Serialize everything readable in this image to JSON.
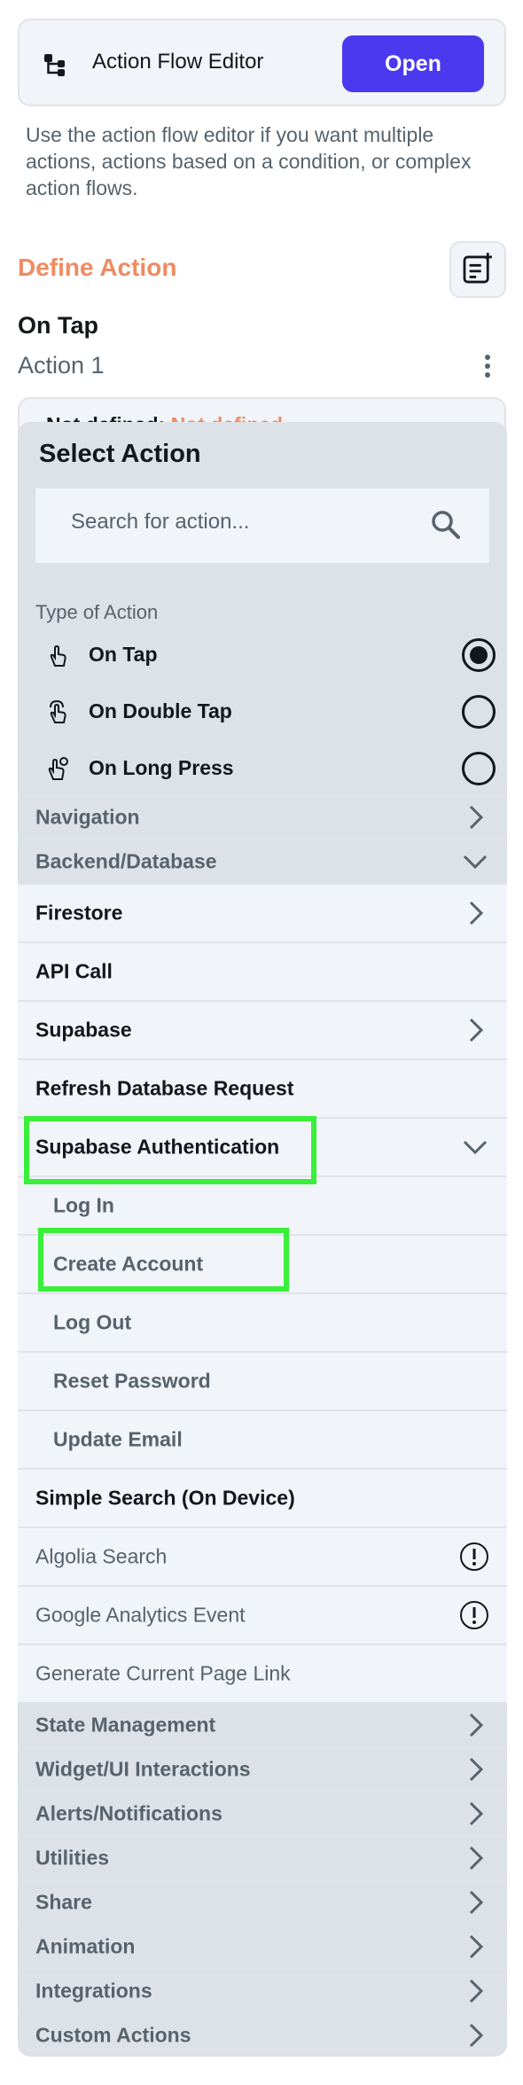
{
  "flow_editor": {
    "title": "Action Flow Editor",
    "open_label": "Open",
    "description": "Use the action flow editor if you want multiple actions, actions based on a condition, or complex action flows."
  },
  "define_action": {
    "title": "Define Action",
    "trigger_label": "On Tap",
    "action_label": "Action 1",
    "hidden_card_text": "Not defined",
    "hidden_card_value": "Not defined"
  },
  "select_action": {
    "title": "Select Action",
    "search_placeholder": "Search for action...",
    "type_label": "Type of Action",
    "triggers": [
      {
        "label": "On Tap",
        "icon": "tap-icon",
        "selected": true
      },
      {
        "label": "On Double Tap",
        "icon": "double-tap-icon",
        "selected": false
      },
      {
        "label": "On Long Press",
        "icon": "long-press-icon",
        "selected": false
      }
    ],
    "categories": {
      "navigation": "Navigation",
      "backend": "Backend/Database",
      "state": "State Management",
      "widget": "Widget/UI Interactions",
      "alerts": "Alerts/Notifications",
      "utilities": "Utilities",
      "share": "Share",
      "animation": "Animation",
      "integrations": "Integrations",
      "custom": "Custom Actions"
    },
    "backend_items": {
      "firestore": "Firestore",
      "api_call": "API Call",
      "supabase": "Supabase",
      "refresh": "Refresh Database Request",
      "supabase_auth": "Supabase Authentication",
      "simple_search": "Simple Search (On Device)",
      "algolia": "Algolia Search",
      "google_analytics": "Google Analytics Event",
      "page_link": "Generate Current Page Link"
    },
    "auth_items": {
      "log_in": "Log In",
      "create_account": "Create Account",
      "log_out": "Log Out",
      "reset_password": "Reset Password",
      "update_email": "Update Email"
    }
  },
  "colors": {
    "accent": "#4b39ef",
    "define_title": "#ee8b60",
    "highlight": "#39ef39"
  }
}
